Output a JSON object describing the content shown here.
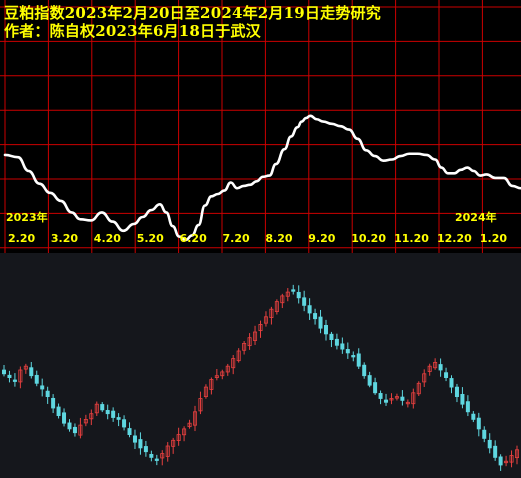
{
  "title_line1": "豆粕指数2023年2月20日至2024年2月19日走势研究",
  "title_line2": "作者：陈自权2023年6月18日于武汉",
  "chart_data": [
    {
      "type": "line",
      "x_tick_labels": [
        "2.20",
        "3.20",
        "4.20",
        "5.20",
        "6.20",
        "7.20",
        "8.20",
        "9.20",
        "10.20",
        "11.20",
        "12.20",
        "1.20"
      ],
      "year_labels": [
        "2023年",
        "2024年"
      ],
      "grid": true,
      "colors": {
        "background": "#000000",
        "grid": "#cc0000",
        "line": "#ffffff",
        "text": "#ffff00"
      },
      "series": [
        {
          "x_months_from_feb20_2023": [
            0,
            0.3,
            0.55,
            0.8,
            1.05,
            1.3,
            1.55,
            1.75,
            2.0,
            2.25,
            2.5,
            2.75,
            3.0,
            3.2,
            3.4,
            3.6,
            3.75,
            3.9,
            4.05,
            4.2,
            4.35,
            4.5,
            4.65,
            4.8,
            4.95,
            5.1,
            5.25,
            5.4,
            5.55,
            5.7,
            5.85,
            6.0,
            6.15,
            6.3,
            6.5,
            6.65,
            6.8,
            6.9,
            7.0,
            7.1,
            7.25,
            7.4,
            7.6,
            7.8,
            8.0,
            8.2,
            8.4,
            8.6,
            8.8,
            9.0,
            9.2,
            9.4,
            9.6,
            9.8,
            10.0,
            10.15,
            10.3,
            10.45,
            10.6,
            10.75,
            10.9,
            11.05,
            11.2,
            11.4,
            11.6,
            11.8,
            12.0
          ],
          "level": [
            74,
            72,
            60,
            49,
            41,
            34,
            24,
            18,
            17,
            24,
            16,
            8,
            14,
            20,
            26,
            31,
            24,
            12,
            3,
            0,
            4,
            13,
            30,
            38,
            40,
            43,
            50,
            45,
            47,
            48,
            51,
            55,
            56,
            66,
            79,
            90,
            98,
            103,
            106,
            108,
            105,
            103,
            101,
            99,
            96,
            88,
            78,
            73,
            69,
            70,
            73,
            75,
            75,
            74,
            70,
            63,
            58,
            58,
            61,
            63,
            60,
            56,
            57,
            54,
            54,
            47,
            45
          ]
        }
      ]
    },
    {
      "type": "candlestick",
      "grid": false,
      "colors": {
        "background": "#15171c",
        "up": "#e8403f",
        "down": "#5fd7e0",
        "text": "#cccccc"
      },
      "note": "cyan = falling candle, red = rising candle; price values not printed on axis",
      "series": [
        {
          "name": "豆粕指数",
          "close_relative": [
            48,
            46,
            44,
            50,
            52,
            47,
            43,
            40,
            36,
            30,
            26,
            22,
            19,
            17,
            21,
            24,
            27,
            32,
            29,
            27,
            25,
            24,
            20,
            16,
            12,
            9,
            7,
            4,
            3,
            6,
            10,
            13,
            16,
            19,
            22,
            28,
            35,
            41,
            45,
            47,
            49,
            52,
            56,
            60,
            64,
            67,
            70,
            74,
            78,
            82,
            86,
            89,
            91,
            92,
            88,
            84,
            80,
            77,
            72,
            69,
            66,
            63,
            61,
            59,
            57,
            52,
            47,
            42,
            38,
            35,
            33,
            35,
            36,
            34,
            33,
            38,
            43,
            48,
            52,
            54,
            50,
            46,
            41,
            36,
            32,
            28,
            24,
            19,
            14,
            9,
            4,
            0,
            2,
            5,
            8
          ]
        }
      ]
    }
  ]
}
